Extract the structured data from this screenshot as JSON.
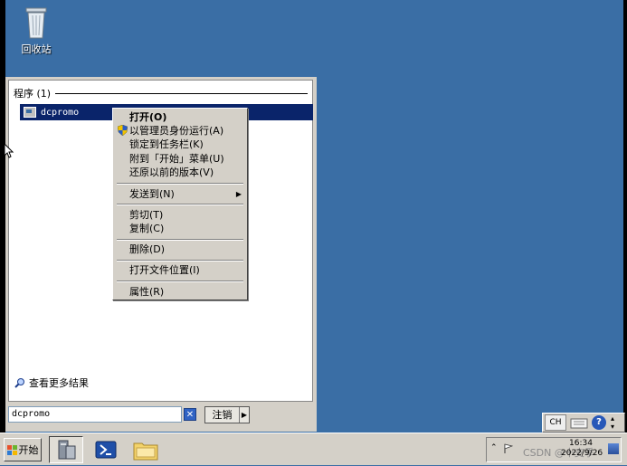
{
  "desktop": {
    "recycle_bin_label": "回收站"
  },
  "start_menu": {
    "group_header": "程序 (1)",
    "result_item": "dcpromo",
    "see_more": "查看更多结果",
    "search_value": "dcpromo",
    "logoff_label": "注销"
  },
  "context_menu": {
    "items": [
      {
        "label": "打开(O)"
      },
      {
        "label": "以管理员身份运行(A)"
      },
      {
        "label": "锁定到任务栏(K)"
      },
      {
        "label": "附到「开始」菜单(U)"
      },
      {
        "label": "还原以前的版本(V)"
      },
      {
        "label": "发送到(N)"
      },
      {
        "label": "剪切(T)"
      },
      {
        "label": "复制(C)"
      },
      {
        "label": "删除(D)"
      },
      {
        "label": "打开文件位置(I)"
      },
      {
        "label": "属性(R)"
      }
    ]
  },
  "taskbar": {
    "start_label": "开始",
    "lang_indicator": "CH",
    "help_glyph": "?",
    "clock_time": "16:34",
    "clock_date": "2022/9/26",
    "watermark": "CSDN @十支季"
  },
  "colors": {
    "desktop": "#3a6ea5",
    "selection": "#0a246a",
    "menu_face": "#d4d0c8"
  }
}
